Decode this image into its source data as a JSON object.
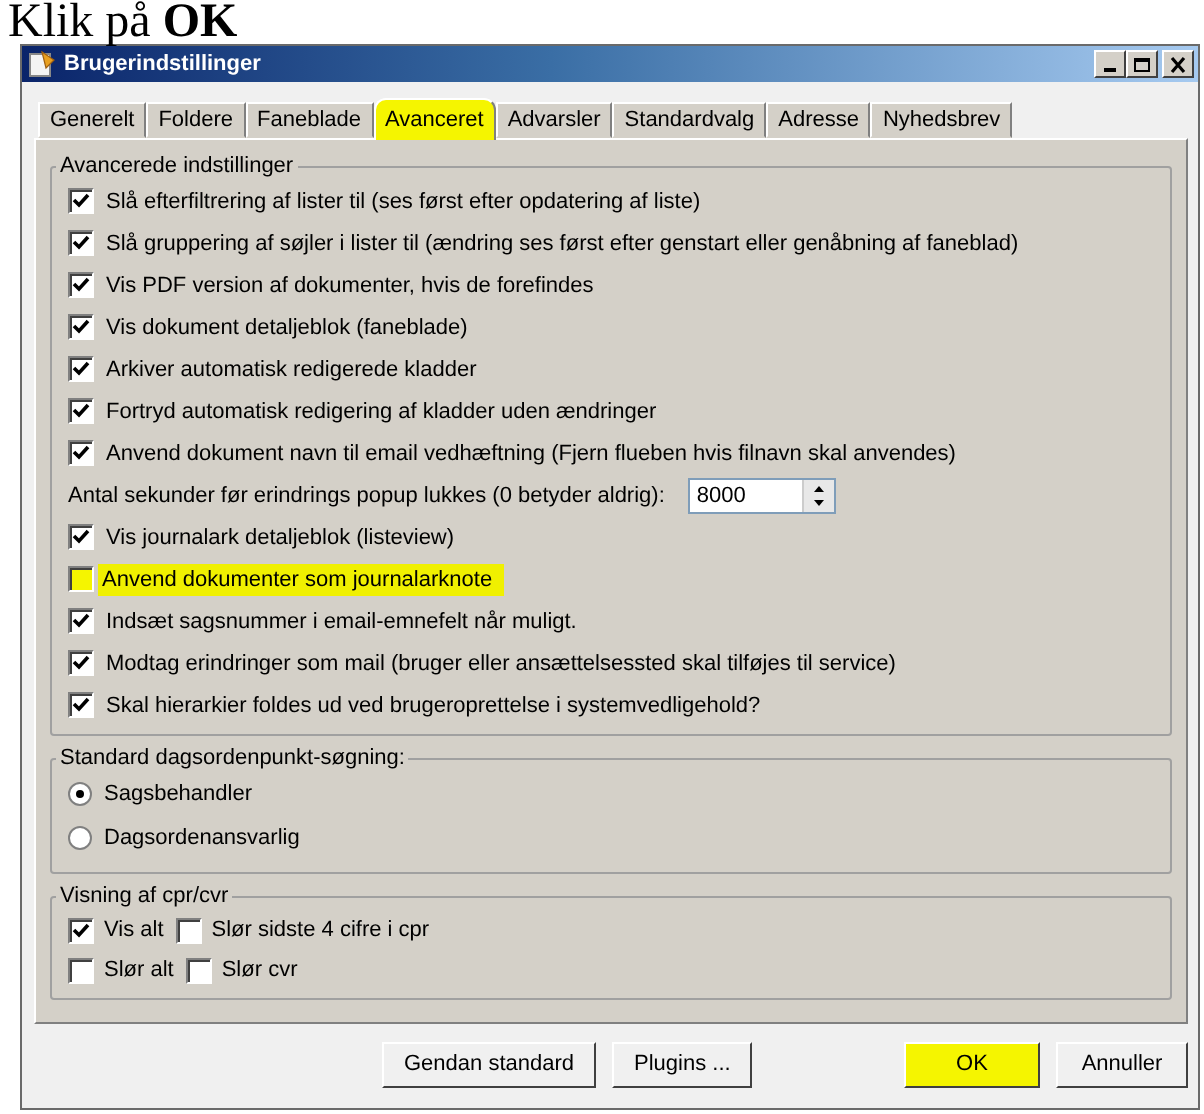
{
  "caption": "Klik på **OK**",
  "window": {
    "title": "Brugerindstillinger"
  },
  "tabs": [
    {
      "label": "Generelt",
      "selected": false,
      "highlighted": false
    },
    {
      "label": "Foldere",
      "selected": false,
      "highlighted": false
    },
    {
      "label": "Faneblade",
      "selected": false,
      "highlighted": false
    },
    {
      "label": "Avanceret",
      "selected": true,
      "highlighted": true
    },
    {
      "label": "Advarsler",
      "selected": false,
      "highlighted": false
    },
    {
      "label": "Standardvalg",
      "selected": false,
      "highlighted": false
    },
    {
      "label": "Adresse",
      "selected": false,
      "highlighted": false
    },
    {
      "label": "Nyhedsbrev",
      "selected": false,
      "highlighted": false
    }
  ],
  "advanced": {
    "title": "Avancerede indstillinger",
    "items": [
      {
        "kind": "checkbox",
        "label": "Slå efterfiltrering af lister til (ses først efter opdatering af liste)",
        "checked": true,
        "highlighted": false
      },
      {
        "kind": "checkbox",
        "label": "Slå gruppering af søjler i lister til  (ændring ses først efter genstart eller genåbning af faneblad)",
        "checked": true,
        "highlighted": false
      },
      {
        "kind": "checkbox",
        "label": "Vis PDF version af dokumenter, hvis de forefindes",
        "checked": true,
        "highlighted": false
      },
      {
        "kind": "checkbox",
        "label": "Vis dokument detaljeblok (faneblade)",
        "checked": true,
        "highlighted": false
      },
      {
        "kind": "checkbox",
        "label": "Arkiver automatisk redigerede kladder",
        "checked": true,
        "highlighted": false
      },
      {
        "kind": "checkbox",
        "label": "Fortryd automatisk redigering af kladder uden ændringer",
        "checked": true,
        "highlighted": false
      },
      {
        "kind": "checkbox",
        "label": "Anvend dokument navn til email vedhæftning (Fjern flueben hvis filnavn skal anvendes)",
        "checked": true,
        "highlighted": false
      },
      {
        "kind": "spinner",
        "label": "Antal sekunder før erindrings popup lukkes (0 betyder aldrig):",
        "value": "8000"
      },
      {
        "kind": "checkbox",
        "label": "Vis journalark detaljeblok (listeview)",
        "checked": true,
        "highlighted": false
      },
      {
        "kind": "checkbox",
        "label": "Anvend dokumenter som journalarknote",
        "checked": false,
        "highlighted": true
      },
      {
        "kind": "checkbox",
        "label": "Indsæt sagsnummer i email-emnefelt når muligt.",
        "checked": true,
        "highlighted": false
      },
      {
        "kind": "checkbox",
        "label": "Modtag erindringer som mail (bruger eller ansættelsessted skal tilføjes til service)",
        "checked": true,
        "highlighted": false
      },
      {
        "kind": "checkbox",
        "label": "Skal hierarkier foldes ud ved brugeroprettelse i systemvedligehold?",
        "checked": true,
        "highlighted": false
      }
    ]
  },
  "agenda_search": {
    "title": "Standard dagsordenpunkt-søgning:",
    "options": [
      {
        "label": "Sagsbehandler",
        "selected": true
      },
      {
        "label": "Dagsordenansvarlig",
        "selected": false
      }
    ]
  },
  "cpr_display": {
    "title": "Visning af cpr/cvr",
    "rows": [
      [
        {
          "label": "Vis alt",
          "checked": true
        },
        {
          "label": "Slør sidste 4 cifre i cpr",
          "checked": false
        }
      ],
      [
        {
          "label": "Slør alt",
          "checked": false
        },
        {
          "label": "Slør cvr",
          "checked": false
        }
      ]
    ]
  },
  "buttons": [
    {
      "label": "Gendan standard",
      "highlighted": false
    },
    {
      "label": "Plugins ...",
      "highlighted": false
    },
    {
      "label": "OK",
      "highlighted": true
    },
    {
      "label": "Annuller",
      "highlighted": false
    }
  ]
}
